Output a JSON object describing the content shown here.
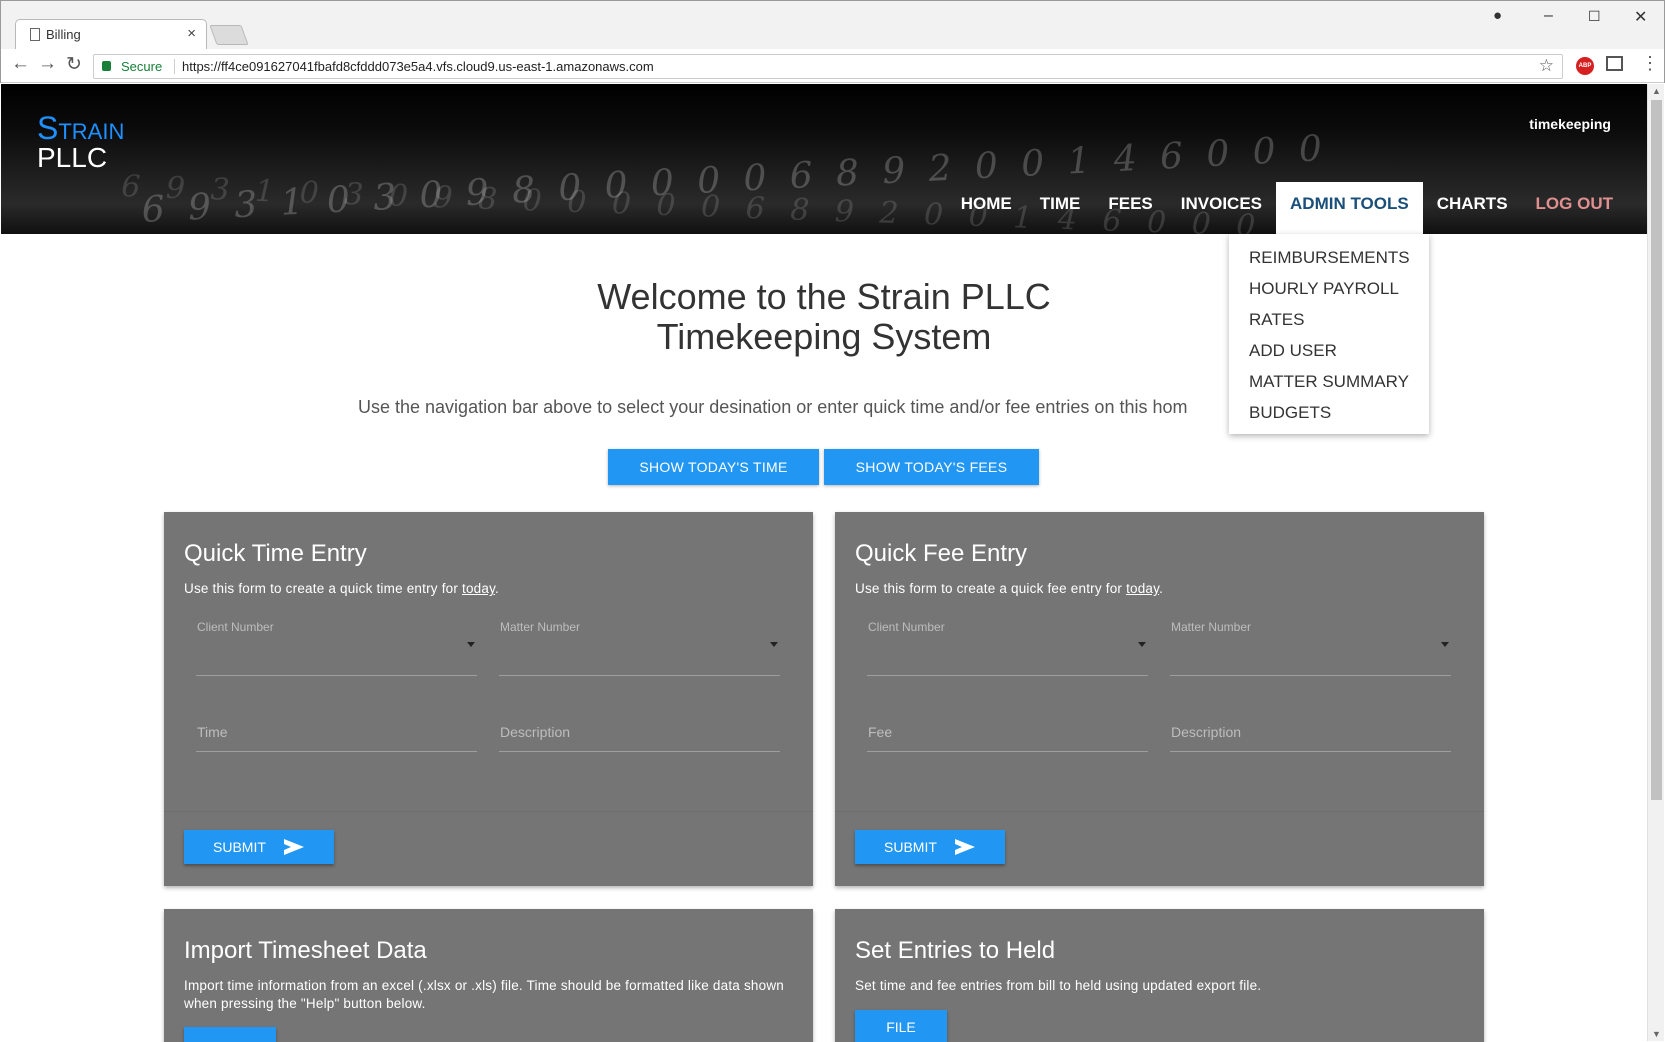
{
  "browser": {
    "tab_title": "Billing",
    "secure_label": "Secure",
    "url": "https://ff4ce091627041fbafd8cfddd073e5a4.vfs.cloud9.us-east-1.amazonaws.com"
  },
  "header": {
    "brand_top": "Strain",
    "brand_bottom": "PLLC",
    "user": "timekeeping",
    "hero_script": "6 9 3 1 0 3 0 9 8 0 0 0 0 0 6 8 9 2 0 0 1 4 6 0 0 0",
    "nav": [
      {
        "label": "HOME"
      },
      {
        "label": "TIME"
      },
      {
        "label": "FEES"
      },
      {
        "label": "INVOICES"
      },
      {
        "label": "ADMIN TOOLS"
      },
      {
        "label": "CHARTS"
      },
      {
        "label": "LOG OUT"
      }
    ]
  },
  "admin_menu": [
    {
      "label": "REIMBURSEMENTS"
    },
    {
      "label": "HOURLY PAYROLL"
    },
    {
      "label": "RATES"
    },
    {
      "label": "ADD USER"
    },
    {
      "label": "MATTER SUMMARY"
    },
    {
      "label": "BUDGETS"
    }
  ],
  "welcome": {
    "line1": "Welcome to the Strain PLLC",
    "line2": "Timekeeping System",
    "lead": "Use the navigation bar above to select your desination or enter quick time and/or fee entries on this hom"
  },
  "buttons": {
    "show_time": "SHOW TODAY'S TIME",
    "show_fees": "SHOW TODAY'S FEES"
  },
  "quick_time": {
    "title": "Quick Time Entry",
    "sub_before": "Use this form to create a quick time entry for ",
    "sub_link": "today",
    "sub_after": ".",
    "client_label": "Client Number",
    "matter_label": "Matter Number",
    "time_placeholder": "Time",
    "description_placeholder": "Description",
    "submit": "SUBMIT"
  },
  "quick_fee": {
    "title": "Quick Fee Entry",
    "sub_before": "Use this form to create a quick fee entry for ",
    "sub_link": "today",
    "sub_after": ".",
    "client_label": "Client Number",
    "matter_label": "Matter Number",
    "fee_placeholder": "Fee",
    "description_placeholder": "Description",
    "submit": "SUBMIT"
  },
  "import": {
    "title": "Import Timesheet Data",
    "sub": "Import time information from an excel (.xlsx or .xls) file. Time should be formatted like data shown when pressing the \"Help\" button below."
  },
  "held": {
    "title": "Set Entries to Held",
    "sub": "Set time and fee entries from bill to held using updated export file.",
    "file_button": "FILE"
  },
  "colors": {
    "accent": "#2196f3",
    "card": "#757575",
    "brand_blue": "#1e90ff",
    "logout": "#e09090"
  }
}
